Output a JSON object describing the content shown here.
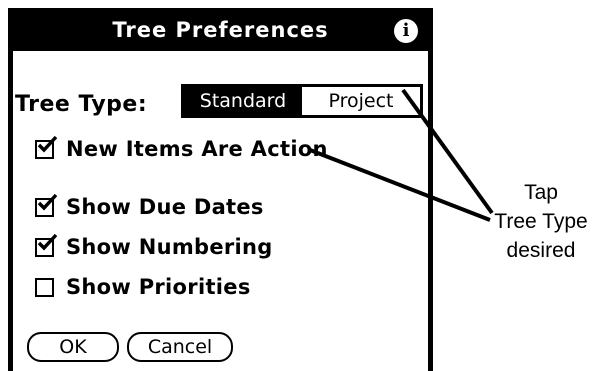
{
  "dialog": {
    "title": "Tree Preferences",
    "info_icon": "info-icon"
  },
  "tree_type": {
    "label": "Tree Type:",
    "options": [
      "Standard",
      "Project"
    ],
    "selected": "Standard"
  },
  "options": [
    {
      "label": "New Items Are Action",
      "checked": true
    },
    {
      "label": "Show Due Dates",
      "checked": true
    },
    {
      "label": "Show Numbering",
      "checked": true
    },
    {
      "label": "Show Priorities",
      "checked": false
    }
  ],
  "buttons": {
    "ok": "OK",
    "cancel": "Cancel"
  },
  "callout": {
    "line1": "Tap",
    "line2": "Tree Type",
    "line3": "desired"
  }
}
